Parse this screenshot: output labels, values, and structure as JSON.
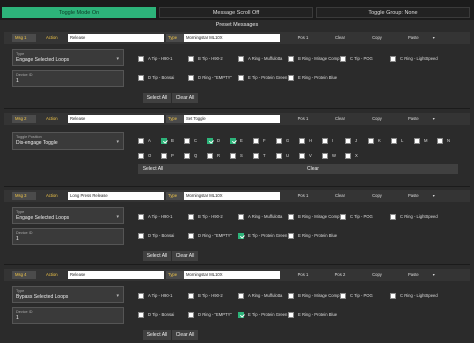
{
  "tabs": [
    "Toggle Mode On",
    "Message Scroll Off",
    "Toggle Group: None"
  ],
  "preset_title": "Preset Messages",
  "colors": {
    "accent": "#2db47a",
    "label": "#f0c548"
  },
  "header_buttons": [
    "Pos 1",
    "Clear",
    "Copy",
    "Paste"
  ],
  "header_buttons_next": [
    "Pos 1",
    "Pos 2",
    "Copy",
    "Paste"
  ],
  "type_label": "Type",
  "action_label": "Action",
  "select_all": "Select All",
  "clear_all": "Clear All",
  "clear": "Clear",
  "device_label": "Device ID",
  "toggle_position_label": "Toggle Position",
  "loops": [
    "A Tip - H90-1",
    "B Tip - H90-2",
    "A Ring - Muffulotta",
    "B Ring - Mirage Comp",
    "C Tip - POG",
    "C Ring - LightSpeed",
    "D Tip - Bonsai",
    "D Ring - \"EMPTY\"",
    "E Tip - Protein Green",
    "E Ring - Protein Blue"
  ],
  "letters": [
    "A",
    "B",
    "C",
    "D",
    "E",
    "F",
    "G",
    "H",
    "I",
    "J",
    "K",
    "L",
    "M",
    "N",
    "O",
    "P",
    "Q",
    "R",
    "S",
    "T",
    "U",
    "V",
    "W",
    "X"
  ],
  "messages": [
    {
      "tag": "Msg 1",
      "action": "Release",
      "type": "Morningstar ML10X",
      "mode_label": "Type",
      "mode": "Engage Selected Loops",
      "device": "1",
      "checked": [
        false,
        false,
        false,
        false,
        false,
        false,
        false,
        false,
        false,
        false
      ]
    },
    {
      "tag": "Msg 2",
      "action": "Release",
      "type": "Set Toggle",
      "position": "Dis-engage Toggle",
      "device": "1",
      "letters_checked": [
        false,
        true,
        false,
        true,
        true,
        false,
        false,
        false,
        false,
        false,
        false,
        false,
        false,
        false,
        false,
        false,
        false,
        false,
        false,
        false,
        false,
        false,
        false,
        false
      ]
    },
    {
      "tag": "Msg 3",
      "action": "Long Press Release",
      "type": "Morningstar ML10X",
      "mode_label": "Type",
      "mode": "Engage Selected Loops",
      "device": "1",
      "checked": [
        false,
        false,
        false,
        false,
        false,
        false,
        false,
        false,
        true,
        false
      ]
    },
    {
      "tag": "Msg 4",
      "action": "Release",
      "type": "Morningstar ML10X",
      "mode_label": "Type",
      "mode": "Bypass Selected Loops",
      "device": "1",
      "checked": [
        false,
        false,
        false,
        false,
        false,
        false,
        false,
        false,
        true,
        false
      ]
    }
  ]
}
